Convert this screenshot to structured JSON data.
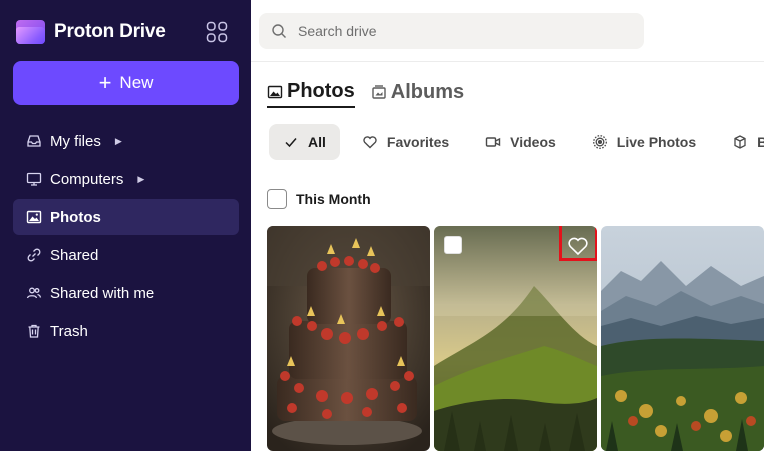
{
  "brand": {
    "name": "Proton Drive"
  },
  "sidebar": {
    "new_label": "New",
    "items": [
      {
        "label": "My files",
        "icon": "inbox-icon",
        "expandable": true
      },
      {
        "label": "Computers",
        "icon": "monitor-icon",
        "expandable": true
      },
      {
        "label": "Photos",
        "icon": "image-icon",
        "active": true
      },
      {
        "label": "Shared",
        "icon": "link-icon"
      },
      {
        "label": "Shared with me",
        "icon": "users-icon"
      },
      {
        "label": "Trash",
        "icon": "trash-icon"
      }
    ]
  },
  "search": {
    "placeholder": "Search drive"
  },
  "tabs": [
    {
      "label": "Photos",
      "active": true
    },
    {
      "label": "Albums"
    }
  ],
  "filters": [
    {
      "label": "All",
      "active": true
    },
    {
      "label": "Favorites"
    },
    {
      "label": "Videos"
    },
    {
      "label": "Live Photos"
    },
    {
      "label": "B"
    }
  ],
  "section": {
    "title": "This Month"
  },
  "photos": [
    {
      "subject": "layered chocolate cake with strawberries"
    },
    {
      "subject": "misty mountain forest at sunrise",
      "hovered": true
    },
    {
      "subject": "mountain valley with autumn forest"
    }
  ],
  "colors": {
    "accent": "#6d4aff",
    "sidebar": "#1b1340",
    "highlight": "#e3121b"
  }
}
